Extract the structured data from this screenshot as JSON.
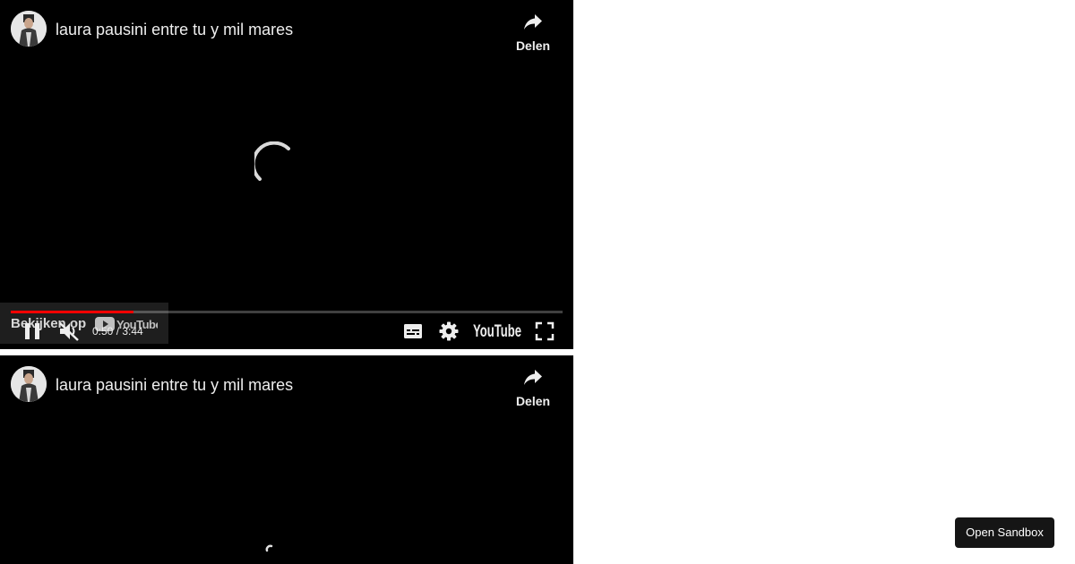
{
  "players": [
    {
      "channel_avatar_icon": "channel-avatar",
      "title": "laura pausini entre tu y mil mares",
      "share": {
        "icon": "share-arrow-icon",
        "label": "Delen"
      },
      "loading_spinner": "loading-spinner-icon",
      "watch_on_youtube": {
        "label": "Bekijken op",
        "logo_icon": "youtube-logo-icon"
      },
      "controls": {
        "pause_icon": "pause-icon",
        "mute_icon": "muted-speaker-icon",
        "current_time": "0:50",
        "separator": " / ",
        "duration": "3:44",
        "subtitles_icon": "subtitles-icon",
        "settings_icon": "gear-icon",
        "youtube_logo_text": "YouTube",
        "fullscreen_icon": "fullscreen-icon"
      },
      "progress_fraction": 0.223
    },
    {
      "channel_avatar_icon": "channel-avatar",
      "title": "laura pausini entre tu y mil mares",
      "share": {
        "icon": "share-arrow-icon",
        "label": "Delen"
      },
      "loading_spinner": "loading-spinner-icon"
    }
  ],
  "sandbox_button": {
    "label": "Open Sandbox"
  },
  "colors": {
    "player_background": "#000000",
    "progress_played": "#ff0000",
    "text": "#eeeeee",
    "sandbox_button_bg": "#151515"
  }
}
